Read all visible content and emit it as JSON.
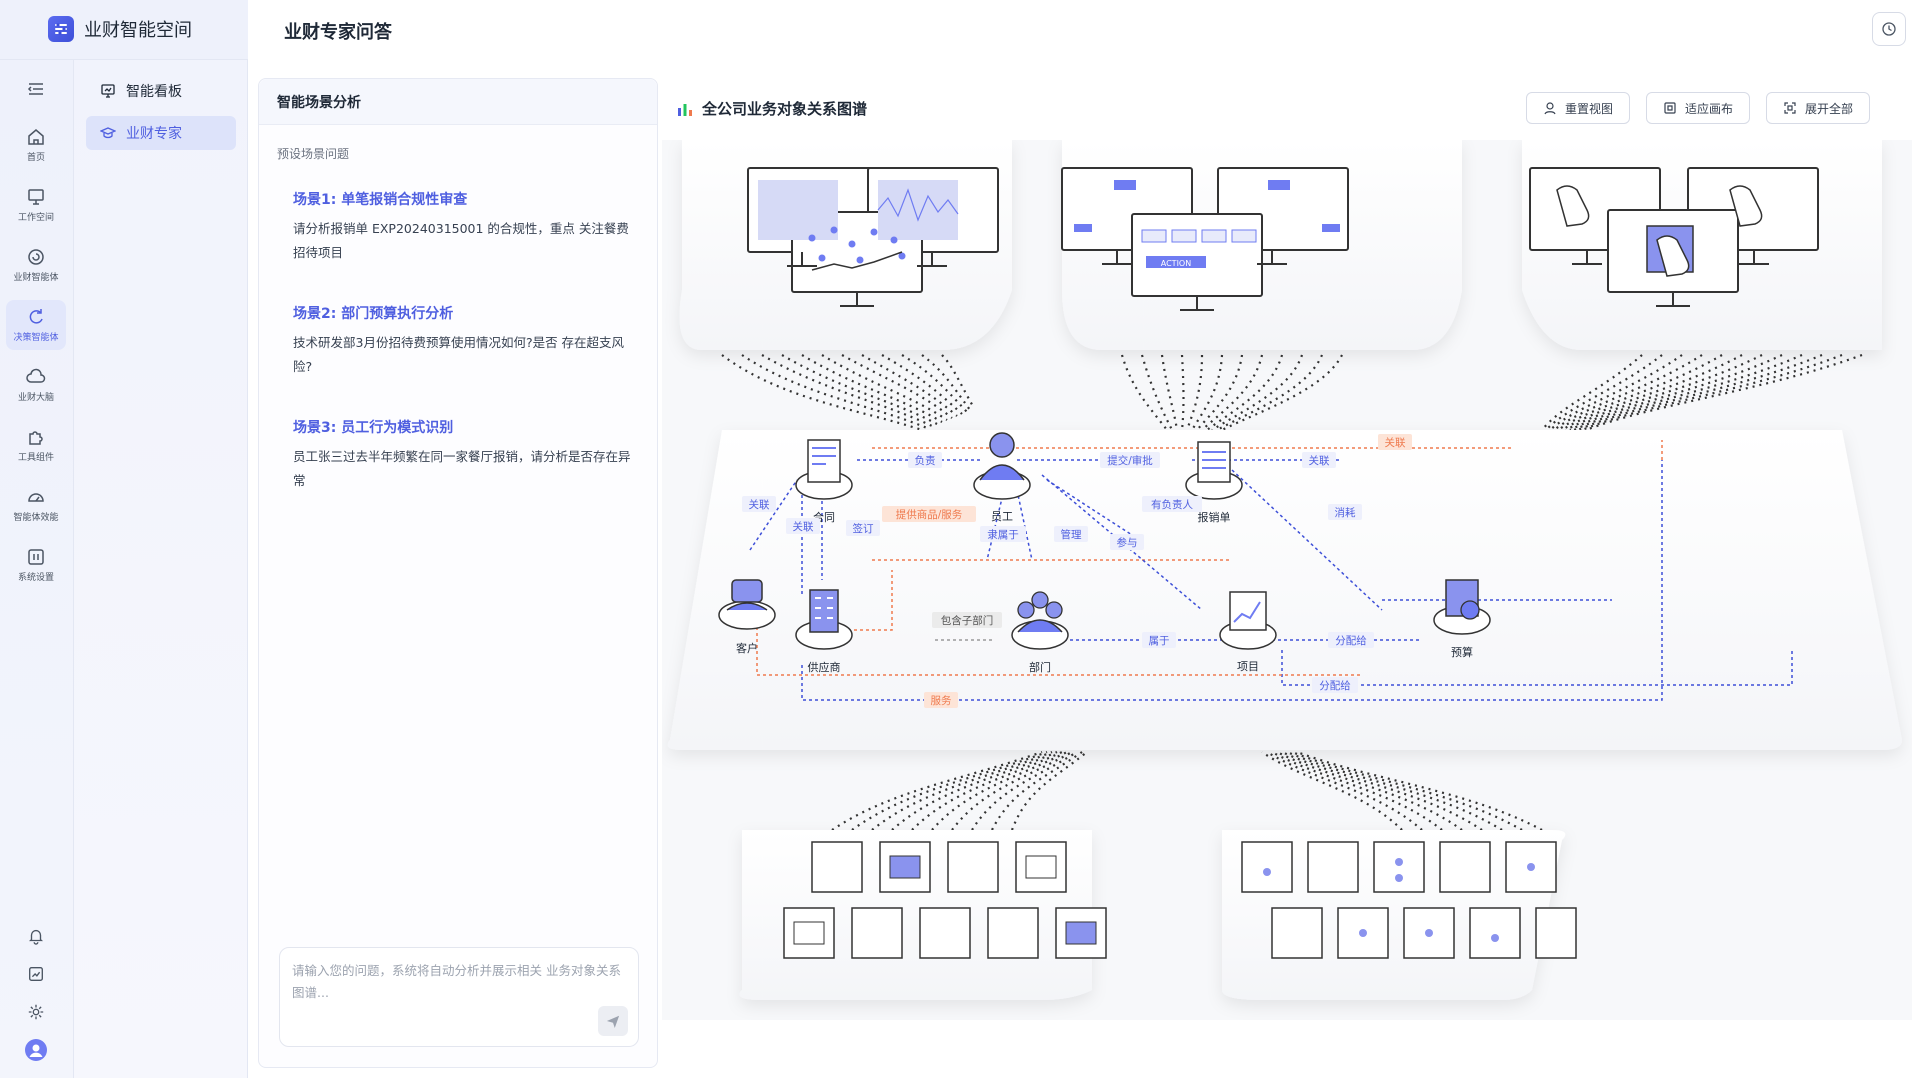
{
  "brand": {
    "title": "业财智能空间"
  },
  "header": {
    "title": "业财专家问答"
  },
  "rail": {
    "items": [
      {
        "label": "首页"
      },
      {
        "label": "工作空间"
      },
      {
        "label": "业财智能体"
      },
      {
        "label": "决策智能体"
      },
      {
        "label": "业财大脑"
      },
      {
        "label": "工具组件"
      },
      {
        "label": "智能体效能"
      },
      {
        "label": "系统设置"
      }
    ]
  },
  "nav2": {
    "items": [
      {
        "label": "智能看板"
      },
      {
        "label": "业财专家"
      }
    ]
  },
  "panel": {
    "title": "智能场景分析",
    "subtitle": "预设场景问题",
    "scenarios": [
      {
        "title": "场景1: 单笔报销合规性审查",
        "text": "请分析报销单 EXP20240315001 的合规性，重点 关注餐费招待项目"
      },
      {
        "title": "场景2: 部门预算执行分析",
        "text": "技术研发部3月份招待费预算使用情况如何?是否 存在超支风险?"
      },
      {
        "title": "场景3: 员工行为模式识别",
        "text": "员工张三过去半年频繁在同一家餐厅报销，请分析是否存在异常"
      }
    ],
    "input_placeholder": "请输入您的问题，系统将自动分析并展示相关 业务对象关系图谱..."
  },
  "graph": {
    "title": "全公司业务对象关系图谱",
    "buttons": {
      "reset": "重置视图",
      "fit": "适应画布",
      "expand": "展开全部"
    },
    "nodes": {
      "contract": "合同",
      "employee": "员工",
      "expense": "报销单",
      "customer": "客户",
      "supplier": "供应商",
      "department": "部门",
      "project": "项目",
      "budget": "预算"
    },
    "edges": {
      "responsible": "负责",
      "submit_approve": "提交/审批",
      "related1": "关联",
      "related2": "关联",
      "related3": "关联",
      "related4": "关联",
      "sign": "签订",
      "provide": "提供商品/服务",
      "belongs_to": "隶属于",
      "manage": "管理",
      "has_owner": "有负责人",
      "participate": "参与",
      "consume": "消耗",
      "contains_dept": "包含子部门",
      "belong": "属于",
      "allocate1": "分配给",
      "allocate2": "分配给",
      "service": "服务"
    },
    "screen_action_label": "ACTION"
  },
  "colors": {
    "accent": "#4f5fe0",
    "orange": "#ef7a4e",
    "blue_edge": "#3d4fd8"
  }
}
